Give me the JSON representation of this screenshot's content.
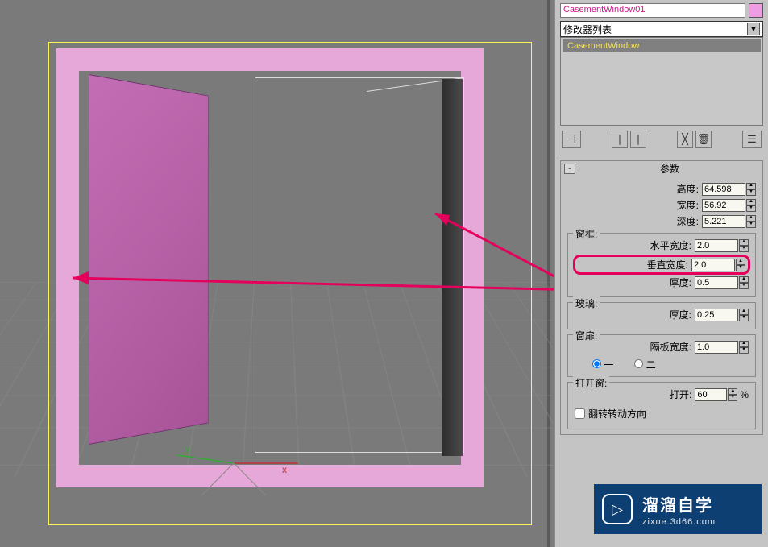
{
  "object_name": "CasementWindow01",
  "modifier_dropdown": "修改器列表",
  "mod_stack_item": "CasementWindow",
  "rollout_params_title": "参数",
  "params": {
    "height_label": "高度:",
    "height_value": "64.598",
    "width_label": "宽度:",
    "width_value": "56.92",
    "depth_label": "深度:",
    "depth_value": "5.221"
  },
  "frame": {
    "group_title": "窗框:",
    "hwidth_label": "水平宽度:",
    "hwidth_value": "2.0",
    "vwidth_label": "垂直宽度:",
    "vwidth_value": "2.0",
    "thickness_label": "厚度:",
    "thickness_value": "0.5"
  },
  "glass": {
    "group_title": "玻璃:",
    "thickness_label": "厚度:",
    "thickness_value": "0.25"
  },
  "sash": {
    "group_title": "窗扉:",
    "panel_width_label": "隔板宽度:",
    "panel_width_value": "1.0",
    "opt_one": "一",
    "opt_two": "二"
  },
  "open": {
    "group_title": "打开窗:",
    "open_label": "打开:",
    "open_value": "60",
    "pct": "%",
    "flip_label": "翻转转动方向"
  },
  "axis": {
    "x": "x",
    "y": "y"
  },
  "watermark": {
    "title": "溜溜自学",
    "sub": "zixue.3d66.com"
  }
}
